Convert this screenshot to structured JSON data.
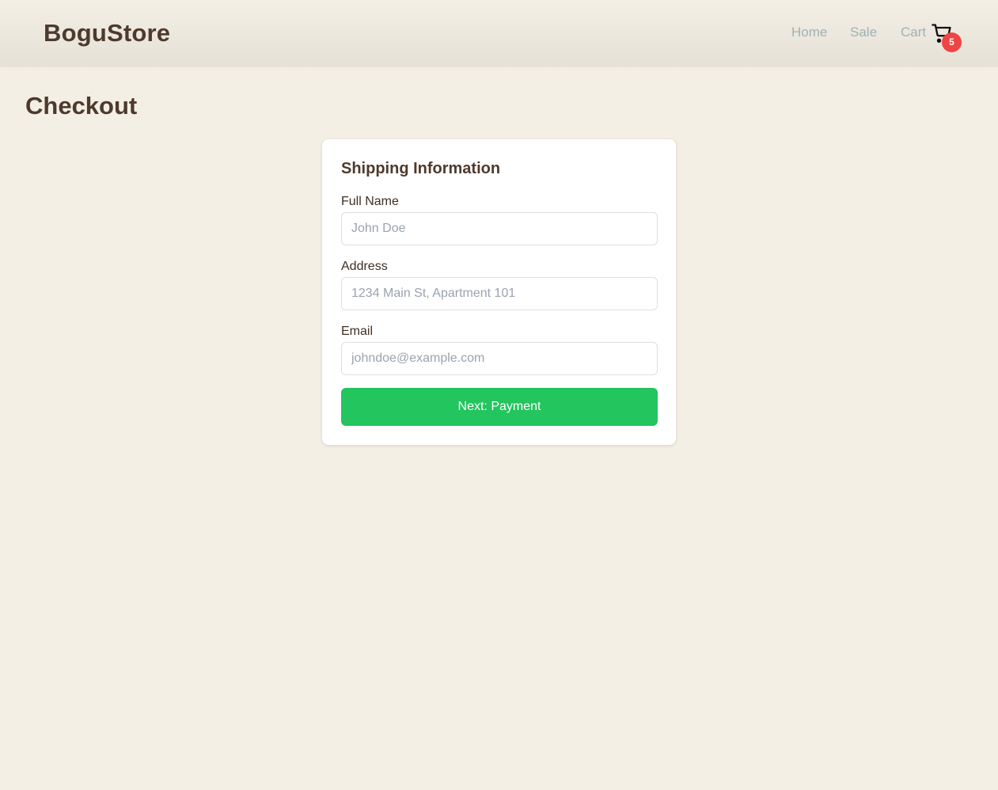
{
  "header": {
    "brand": "BoguStore",
    "nav": {
      "home": "Home",
      "sale": "Sale",
      "cart": "Cart"
    },
    "cart_icon": "shopping-cart-icon",
    "cart_count": "5",
    "badge_color": "#ef4444"
  },
  "page": {
    "title": "Checkout"
  },
  "form": {
    "title": "Shipping Information",
    "full_name": {
      "label": "Full Name",
      "placeholder": "John Doe",
      "value": ""
    },
    "address": {
      "label": "Address",
      "placeholder": "1234 Main St, Apartment 101",
      "value": ""
    },
    "email": {
      "label": "Email",
      "placeholder": "johndoe@example.com",
      "value": ""
    },
    "submit_label": "Next: Payment",
    "submit_color": "#22c55e"
  }
}
